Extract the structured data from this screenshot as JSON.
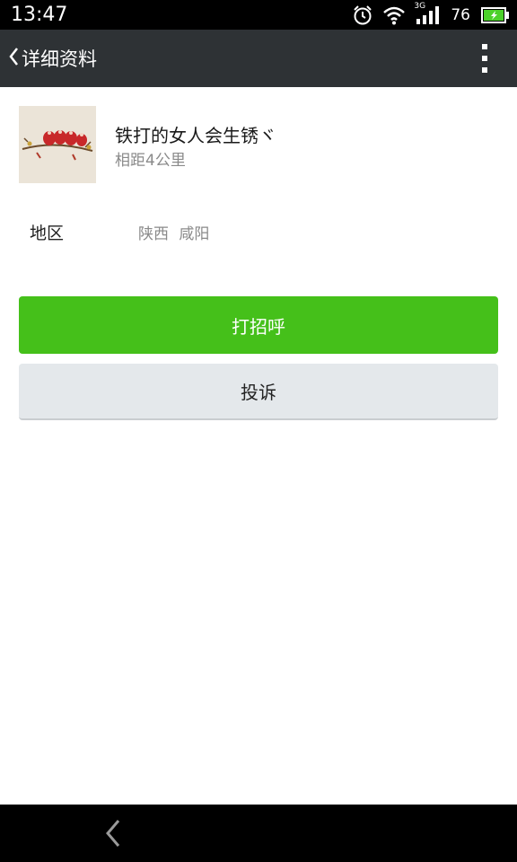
{
  "status": {
    "time": "13:47",
    "network": "3G",
    "battery": "76",
    "icons": [
      "alarm-icon",
      "wifi-icon",
      "signal-icon",
      "battery-icon"
    ]
  },
  "appbar": {
    "title": "详细资料",
    "back_icon": "chevron-left-icon",
    "more_icon": "more-vertical-icon"
  },
  "profile": {
    "nickname": "铁打的女人会生锈ヾ",
    "distance": "相距4公里"
  },
  "region": {
    "label": "地区",
    "value": "陕西 咸阳"
  },
  "actions": {
    "greet": "打招呼",
    "report": "投诉"
  },
  "colors": {
    "primary": "#45c01a",
    "appbar": "#2e3235",
    "secondary_button": "#e4e8eb"
  }
}
